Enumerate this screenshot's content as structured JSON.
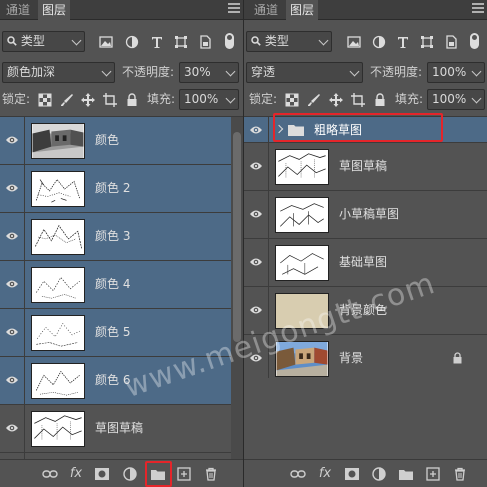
{
  "left_panel": {
    "tabs": [
      {
        "label": "通道"
      },
      {
        "label": "图层"
      }
    ],
    "filter_type": "类型",
    "blend_mode": "颜色加深",
    "opacity_label": "不透明度:",
    "opacity_value": "30%",
    "lock_label": "锁定:",
    "fill_label": "填充:",
    "fill_value": "100%",
    "layers": [
      {
        "name": "颜色",
        "selected": true,
        "thumb": "photo"
      },
      {
        "name": "颜色 2",
        "selected": true,
        "thumb": "sketch"
      },
      {
        "name": "颜色 3",
        "selected": true,
        "thumb": "sketch"
      },
      {
        "name": "颜色 4",
        "selected": true,
        "thumb": "sketch"
      },
      {
        "name": "颜色 5",
        "selected": true,
        "thumb": "sketch"
      },
      {
        "name": "颜色 6",
        "selected": true,
        "thumb": "sketch"
      },
      {
        "name": "草图草稿",
        "selected": false,
        "thumb": "sketch"
      }
    ]
  },
  "right_panel": {
    "tabs": [
      {
        "label": "通道"
      },
      {
        "label": "图层"
      }
    ],
    "filter_type": "类型",
    "blend_mode": "穿透",
    "opacity_label": "不透明度:",
    "opacity_value": "100%",
    "lock_label": "锁定:",
    "fill_label": "填充:",
    "fill_value": "100%",
    "group": {
      "name": "粗略草图"
    },
    "layers": [
      {
        "name": "草图草稿",
        "thumb": "sketch"
      },
      {
        "name": "小草稿草图",
        "thumb": "sketch"
      },
      {
        "name": "基础草图",
        "thumb": "sketch"
      },
      {
        "name": "背景颜色",
        "thumb": "beige"
      },
      {
        "name": "背景",
        "thumb": "photo",
        "locked": true
      }
    ]
  },
  "bottom_icons": [
    "link-icon",
    "fx-icon",
    "mask-icon",
    "adjustment-icon",
    "new-group-icon",
    "new-layer-icon",
    "trash-icon"
  ],
  "watermark": "www.meigongtt.com",
  "colors": {
    "panel_bg": "#535353",
    "selected_row": "#4d6a87",
    "highlight_red": "#e5252a",
    "beige_swatch": "#d8cdb0"
  }
}
